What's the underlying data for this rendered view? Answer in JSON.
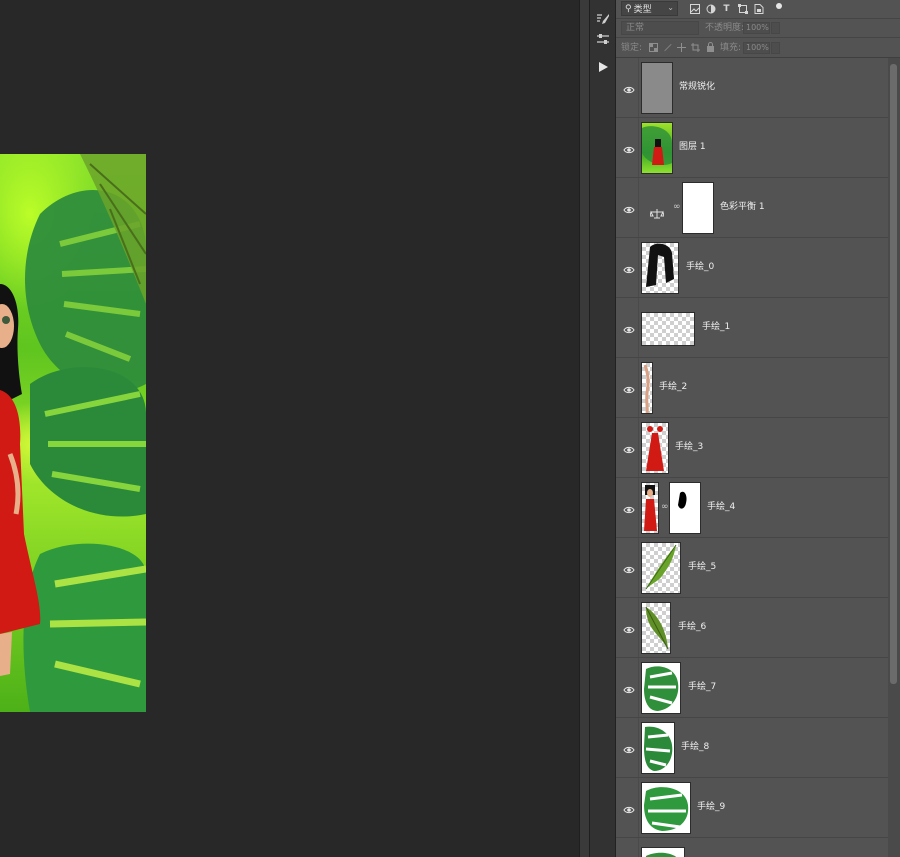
{
  "panel": {
    "filter_type": "类型",
    "blend_mode": "正常",
    "opacity_label": "不透明度:",
    "opacity_value": "100%",
    "lock_label": "锁定:",
    "fill_label": "填充:",
    "fill_value": "100%"
  },
  "toolstrip": {
    "icons": [
      "brush-settings-icon",
      "adjustments-icon",
      "play-actions-icon"
    ]
  },
  "layers": [
    {
      "name": "常规锐化",
      "thumb": "gray"
    },
    {
      "name": "图层 1",
      "thumb": "image"
    },
    {
      "name": "色彩平衡 1",
      "thumb": "adjustment-mask"
    },
    {
      "name": "手绘_0",
      "thumb": "hair"
    },
    {
      "name": "手绘_1",
      "thumb": "transparent"
    },
    {
      "name": "手绘_2",
      "thumb": "arm"
    },
    {
      "name": "手绘_3",
      "thumb": "dress"
    },
    {
      "name": "手绘_4",
      "thumb": "girl-mask"
    },
    {
      "name": "手绘_5",
      "thumb": "palm-leaf"
    },
    {
      "name": "手绘_6",
      "thumb": "palm-leaf-2"
    },
    {
      "name": "手绘_7",
      "thumb": "monstera"
    },
    {
      "name": "手绘_8",
      "thumb": "monstera-2"
    },
    {
      "name": "手绘_9",
      "thumb": "monstera-3"
    },
    {
      "name": "",
      "thumb": "monstera-partial"
    }
  ],
  "colors": {
    "panel_bg": "#535353",
    "canvas_bg": "#282828",
    "dress_red": "#d11a14",
    "leaf_green": "#2f8f3a"
  }
}
